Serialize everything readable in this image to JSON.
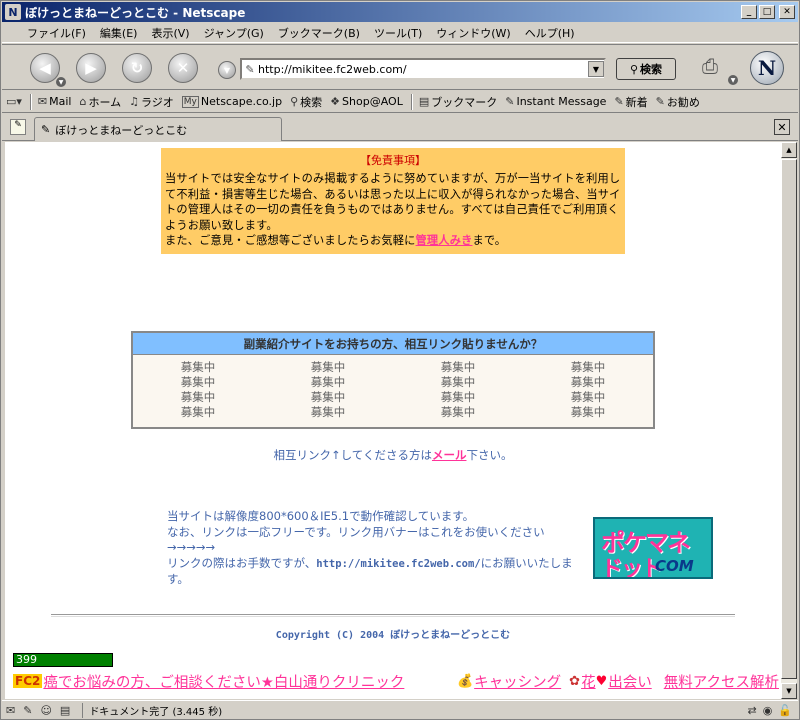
{
  "window": {
    "title": "ぼけっとまねーどっとこむ - Netscape",
    "app_icon": "N"
  },
  "menu": [
    "ファイル(F)",
    "編集(E)",
    "表示(V)",
    "ジャンプ(G)",
    "ブックマーク(B)",
    "ツール(T)",
    "ウィンドウ(W)",
    "ヘルプ(H)"
  ],
  "nav": {
    "url": "http://mikitee.fc2web.com/",
    "search_label": "検索",
    "logo": "N"
  },
  "personal_toolbar": [
    {
      "icon": "mail-icon",
      "glyph": "✉",
      "label": "Mail"
    },
    {
      "icon": "home-icon",
      "glyph": "⌂",
      "label": "ホーム"
    },
    {
      "icon": "radio-icon",
      "glyph": "♫",
      "label": "ラジオ"
    },
    {
      "icon": "my-netscape-icon",
      "glyph": "My",
      "label": "Netscape.co.jp"
    },
    {
      "icon": "search-icon",
      "glyph": "⚲",
      "label": "検索"
    },
    {
      "icon": "aol-shop-icon",
      "glyph": "❖",
      "label": "Shop@AOL"
    },
    {
      "icon": "bookmark-folder-icon",
      "glyph": "▤",
      "label": "ブックマーク"
    },
    {
      "icon": "bookmark-icon",
      "glyph": "✎",
      "label": "Instant Message"
    },
    {
      "icon": "bookmark-icon",
      "glyph": "✎",
      "label": "新着"
    },
    {
      "icon": "bookmark-icon",
      "glyph": "✎",
      "label": "お勧め"
    }
  ],
  "tab": {
    "label": "ぼけっとまねーどっとこむ"
  },
  "disclaimer": {
    "title": "【免責事項】",
    "body": "当サイトでは安全なサイトのみ掲載するように努めていますが、万が一当サイトを利用して不利益・損害等生じた場合、あるいは思った以上に収入が得られなかった場合、当サイトの管理人はその一切の責任を負うものではありません。すべては自己責任でご利用頂くようお願い致します。",
    "contact_prefix": "また、ご意見・ご感想等ございましたらお気軽に",
    "admin_link": "管理人みき",
    "contact_suffix": "まで。"
  },
  "mutual": {
    "header": "副業紹介サイトをお持ちの方、相互リンク貼りませんか？",
    "cells": [
      "募集中",
      "募集中",
      "募集中",
      "募集中",
      "募集中",
      "募集中",
      "募集中",
      "募集中",
      "募集中",
      "募集中",
      "募集中",
      "募集中",
      "募集中",
      "募集中",
      "募集中",
      "募集中"
    ]
  },
  "link_request": {
    "prefix": "相互リンク↑してくださる方は",
    "mail_link": "メール",
    "suffix": "下さい。"
  },
  "info": {
    "line1": "当サイトは解像度800*600＆IE5.1で動作確認しています。",
    "line2": "なお、リンクは一応フリーです。リンク用バナーはこれをお使いください",
    "arrows": "→→→→→",
    "line3_prefix": "リンクの際はお手数ですが、",
    "url": "http://mikitee.fc2web.com/",
    "line3_suffix": "にお願いいたします。"
  },
  "banner": {
    "line1": "ポケマネ",
    "line2": "ドット",
    "line3": "COM"
  },
  "copyright": "Copyright (C) 2004 ぼけっとまねーどっとこむ",
  "counter": "399",
  "fc2bar": {
    "fc2": "FC2",
    "ad1": "癌でお悩みの方、ご相談ください★白山通りクリニック",
    "ad2": "キャッシング",
    "ad3": "花",
    "ad4": "出会い",
    "ad5": "無料アクセス解析"
  },
  "status": {
    "text": "ドキュメント完了 (3.445 秒)"
  },
  "colors": {
    "titlebar_start": "#0a246a",
    "disclaimer_bg": "#ffcc66",
    "mutual_header": "#80bfff",
    "link_pink": "#ff3399",
    "text_blue": "#4466aa"
  }
}
